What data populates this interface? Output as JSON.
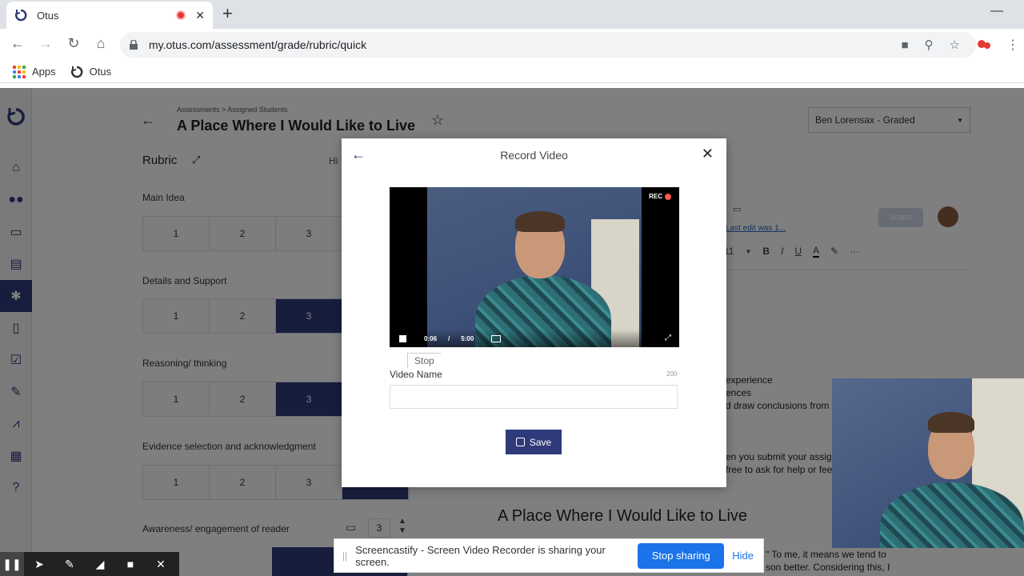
{
  "browser": {
    "tab_title": "Otus",
    "url": "my.otus.com/assessment/grade/rubric/quick",
    "bookmarks": [
      {
        "label": "Apps"
      },
      {
        "label": "Otus"
      }
    ]
  },
  "assignment": {
    "breadcrumb": "Assessments > Assigned Students",
    "title": "A Place Where I Would Like to Live",
    "student": "Ben Lorensax - Graded"
  },
  "rubric": {
    "title": "Rubric",
    "hide_label": "Hi",
    "criteria": [
      {
        "name": "Main Idea",
        "scores": [
          "1",
          "2",
          "3"
        ],
        "selected": "4"
      },
      {
        "name": "Details and Support",
        "scores": [
          "1",
          "2",
          "3"
        ],
        "selected": "3"
      },
      {
        "name": "Reasoning/ thinking",
        "scores": [
          "1",
          "2",
          "3"
        ],
        "selected": "3"
      },
      {
        "name": "Evidence selection and acknowledgment",
        "scores": [
          "1",
          "2",
          "3"
        ],
        "selected": "4"
      },
      {
        "name": "Awareness/ engagement of reader",
        "value": "3"
      }
    ]
  },
  "doc": {
    "last_edit": "Last edit was 1...",
    "share_label": "Share",
    "font_size": "11",
    "lines": [
      "experience",
      "ences",
      "d draw conclusions from t",
      "en you submit your assig",
      "free to ask for help or fee"
    ],
    "heading": "A Place Where I Would Like to Live",
    "body_lines": [
      "\" To me, it means we tend to",
      "son better. Considering this, I"
    ]
  },
  "modal": {
    "title": "Record Video",
    "rec_label": "REC",
    "elapsed": "0:06",
    "separator": "/",
    "limit": "5:00",
    "tooltip": "Stop",
    "name_label": "Video Name",
    "name_count": "200",
    "name_value": "",
    "save_label": "Save"
  },
  "share_bar": {
    "message": "Screencastify - Screen Video Recorder is sharing your screen.",
    "stop_label": "Stop sharing",
    "hide_label": "Hide"
  },
  "colors": {
    "brand": "#2f3a7a",
    "chrome_blue": "#1a73e8",
    "rec_red": "#e53935"
  }
}
